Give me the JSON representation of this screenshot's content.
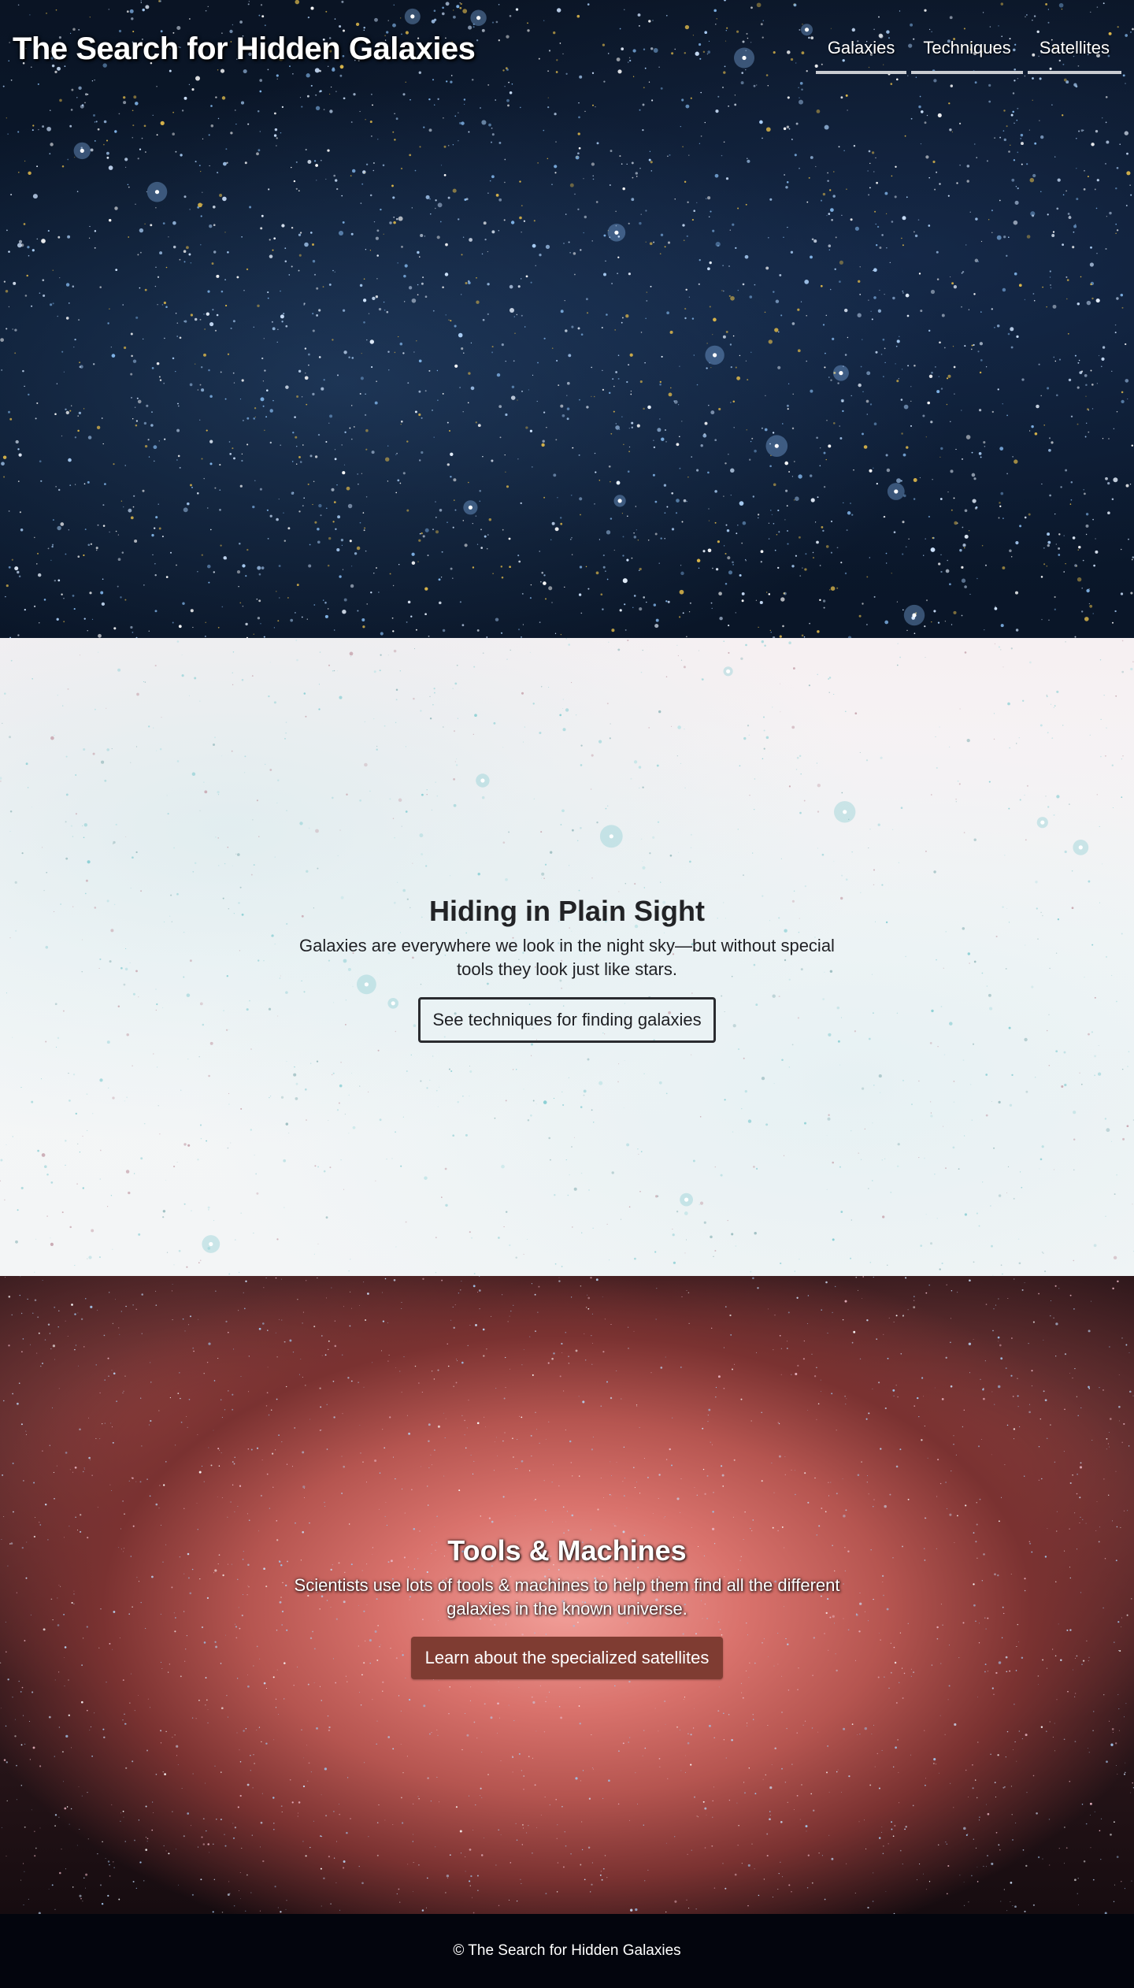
{
  "site": {
    "title": "The Search for Hidden Galaxies"
  },
  "nav": {
    "items": [
      {
        "label": "Galaxies"
      },
      {
        "label": "Techniques"
      },
      {
        "label": "Satellites"
      }
    ]
  },
  "sections": {
    "plain_sight": {
      "title": "Hiding in Plain Sight",
      "text": "Galaxies are everywhere we look in the night sky—but without special tools they look just like stars.",
      "button_label": "See techniques for finding galaxies"
    },
    "tools": {
      "title": "Tools & Machines",
      "text": "Scientists use lots of tools & machines to help them find all the different galaxies in the known universe.",
      "button_label": "Learn about the specialized satellites"
    }
  },
  "footer": {
    "text": "© The Search for Hidden Galaxies"
  },
  "colors": {
    "hero_bg": "#0b1a30",
    "section_light_bg": "#f4f6f7",
    "accent_button": "#7f3c32",
    "footer_bg": "#03050d",
    "nav_underline": "#c9ccd1"
  }
}
